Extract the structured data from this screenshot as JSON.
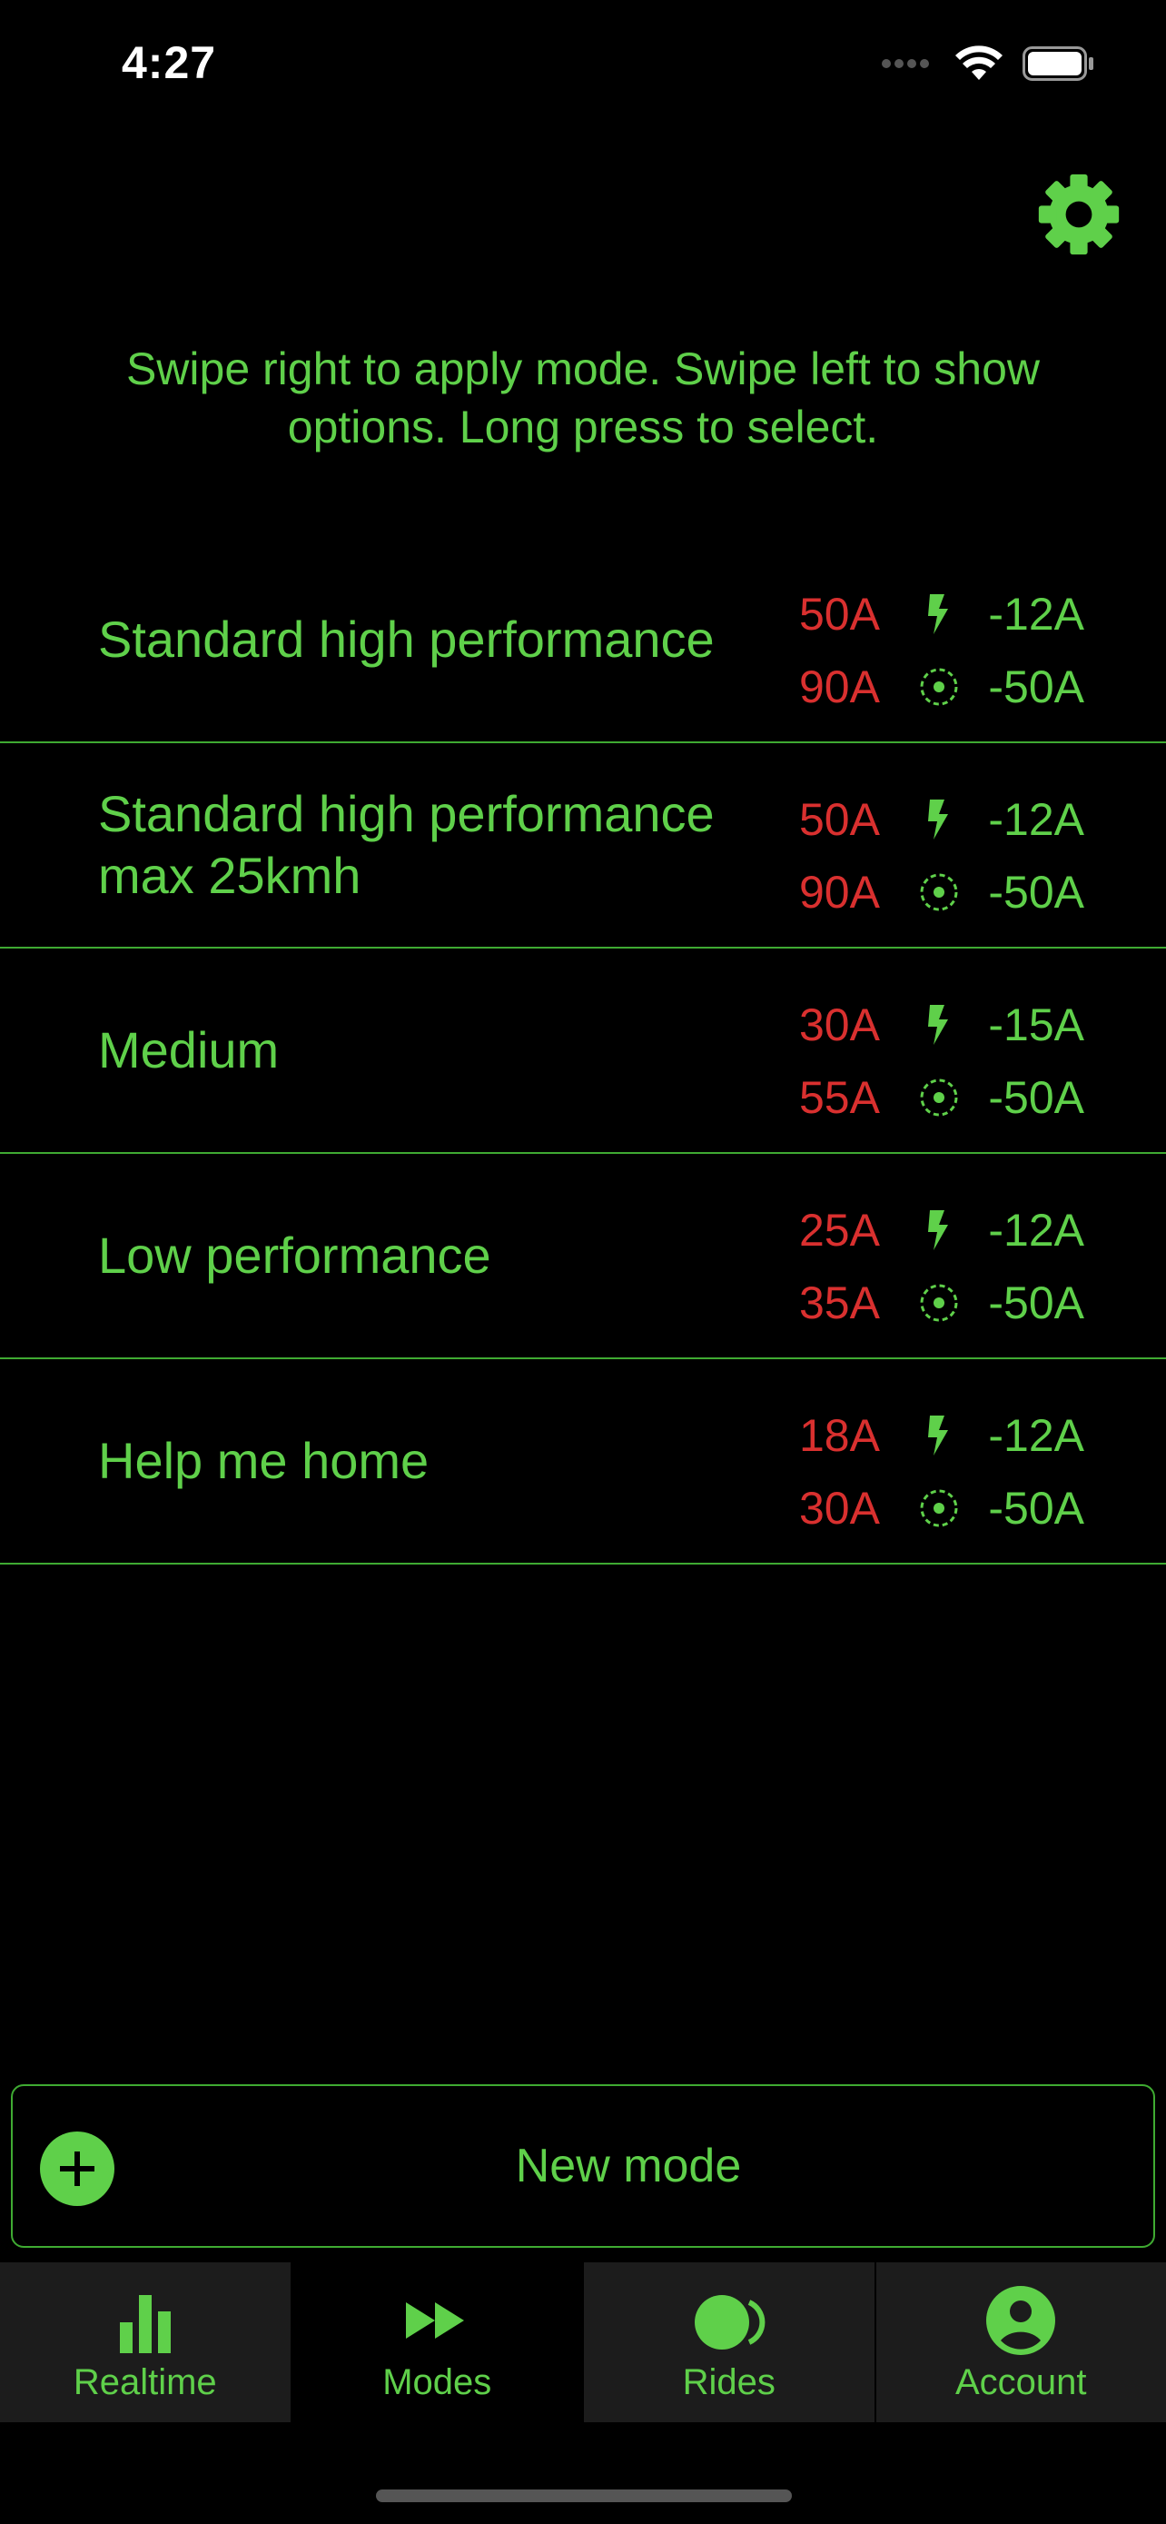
{
  "status": {
    "time": "4:27"
  },
  "hint": "Swipe right to apply mode. Swipe left to show options. Long press to select.",
  "modes": [
    {
      "name": "Standard high performance",
      "motor": "50A",
      "battery": "90A",
      "regen": "-12A",
      "brake": "-50A"
    },
    {
      "name": "Standard high performance max 25kmh",
      "motor": "50A",
      "battery": "90A",
      "regen": "-12A",
      "brake": "-50A"
    },
    {
      "name": "Medium",
      "motor": "30A",
      "battery": "55A",
      "regen": "-15A",
      "brake": "-50A"
    },
    {
      "name": "Low performance",
      "motor": "25A",
      "battery": "35A",
      "regen": "-12A",
      "brake": "-50A"
    },
    {
      "name": "Help me home",
      "motor": "18A",
      "battery": "30A",
      "regen": "-12A",
      "brake": "-50A"
    }
  ],
  "new_mode": {
    "label": "New mode"
  },
  "tabs": [
    {
      "label": "Realtime",
      "icon": "bar-chart-icon"
    },
    {
      "label": "Modes",
      "icon": "fast-forward-icon"
    },
    {
      "label": "Rides",
      "icon": "rides-icon"
    },
    {
      "label": "Account",
      "icon": "account-icon"
    }
  ],
  "colors": {
    "accent": "#5fd04a",
    "current": "#d9302f",
    "background": "#000000",
    "tab_bg": "#1c1c1c"
  }
}
